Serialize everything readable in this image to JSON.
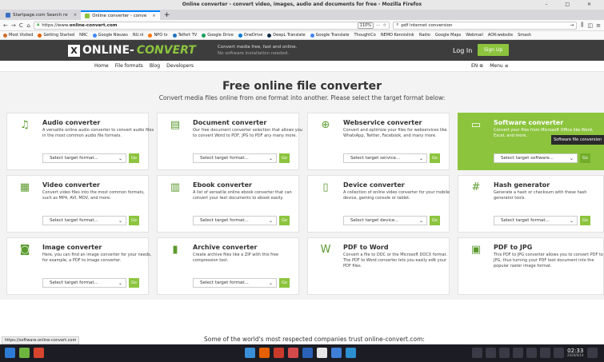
{
  "window": {
    "title": "Online converter - convert video, images, audio and documents for free - Mozilla Firefox",
    "controls": "– □ ✕"
  },
  "tabs": [
    {
      "label": "Startpage.com Search re",
      "close": "×"
    },
    {
      "label": "Online converter - conve",
      "close": "×"
    }
  ],
  "newtab": "+",
  "nav": {
    "back": "←",
    "forward": "→",
    "reload": "C",
    "home": "⌂",
    "url_prefix": "https://www.",
    "url_host": "online-convert.com",
    "zoom": "110%",
    "more": "···",
    "search_value": "pdf internet conversion",
    "search_go": "→"
  },
  "bookmarks": [
    "Most Visited",
    "Getting Started",
    "NRC",
    "Google Nieuws",
    "NU.nl",
    "NPO tv",
    "Telfort TV",
    "Google Drive",
    "OneDrive",
    "DeepL Translate",
    "Google Translate",
    "ThoughtCo",
    "NEMO Kennislink",
    "Radio",
    "Google Maps",
    "Webmail",
    "AOK-website",
    "Smash"
  ],
  "header": {
    "logo_left": "ONLINE-",
    "logo_right": "CONVERT",
    "tagline1": "Convert media free, fast and online.",
    "tagline2": "No software installation needed.",
    "login": "Log In",
    "signup": "Sign Up"
  },
  "subnav": {
    "links": [
      "Home",
      "File formats",
      "Blog",
      "Developers"
    ],
    "lang": "EN ⊕",
    "menu": "Menu ≡"
  },
  "hero": {
    "title": "Free online file converter",
    "subtitle": "Convert media files online from one format into another. Please select the target format below:"
  },
  "cards": [
    {
      "title": "Audio converter",
      "desc": "A versatile online audio converter to convert audio files in the most common audio file formats.",
      "select": "Select target format...",
      "icon": "music-note-icon",
      "glyph": "♫"
    },
    {
      "title": "Document converter",
      "desc": "Our free document converter selection that allows you to convert Word to PDF, JPG to PDF any many more.",
      "select": "Select target format...",
      "icon": "document-icon",
      "glyph": "▤"
    },
    {
      "title": "Webservice converter",
      "desc": "Convert and optimize your files for webservices like WhatsApp, Twitter, Facebook, and many more.",
      "select": "Select target service...",
      "icon": "globe-icon",
      "glyph": "⊕"
    },
    {
      "title": "Software converter",
      "desc": "Convert your files from Microsoft Office like Word, Excel, and more.",
      "select": "Select target software...",
      "icon": "monitor-icon",
      "glyph": "▭"
    },
    {
      "title": "Video converter",
      "desc": "Convert video files into the most common formats, such as MP4, AVI, MOV, and more.",
      "select": "Select target format...",
      "icon": "film-icon",
      "glyph": "▦"
    },
    {
      "title": "Ebook converter",
      "desc": "A list of versatile online ebook converter that can convert your text documents to ebook easily.",
      "select": "Select target format...",
      "icon": "books-icon",
      "glyph": "▥"
    },
    {
      "title": "Device converter",
      "desc": "A collection of online video converter for your mobile device, gaming console or tablet.",
      "select": "Select target device...",
      "icon": "tablet-icon",
      "glyph": "▯"
    },
    {
      "title": "Hash generator",
      "desc": "Generate a hash or checksum with these hash generator tools.",
      "select": "Select target format...",
      "icon": "hash-icon",
      "glyph": "#"
    },
    {
      "title": "Image converter",
      "desc": "Here, you can find an image converter for your needs, for example, a PDF to image converter.",
      "select": "Select target format...",
      "icon": "camera-icon",
      "glyph": "◙"
    },
    {
      "title": "Archive converter",
      "desc": "Create archive files like a ZIP with this free compression tool.",
      "select": "Select target format...",
      "icon": "archive-icon",
      "glyph": "▮"
    },
    {
      "title": "PDF to Word",
      "desc": "Convert a file to DOC or the Microsoft DOCX format. The PDF to Word converter lets you easily edit your PDF files.",
      "select": "",
      "icon": "word-file-icon",
      "glyph": "W"
    },
    {
      "title": "PDF to JPG",
      "desc": "This PDF to JPG converter allows you to convert PDF to JPG, thus turning your PDF text document into the popular raster image format.",
      "select": "",
      "icon": "image-file-icon",
      "glyph": "▣"
    }
  ],
  "go_label": "Go",
  "tooltip": "Software file conversion",
  "status_url": "https://software.online-convert.com",
  "trust_text": "Some of the world's most respected companies trust online-convert.com:",
  "clock": {
    "time": "02:33",
    "date": "2020/6/14"
  },
  "colors": {
    "accent": "#8cc43e",
    "header_bg": "#3d3d3d",
    "tab_accent": "#0a84ff"
  }
}
